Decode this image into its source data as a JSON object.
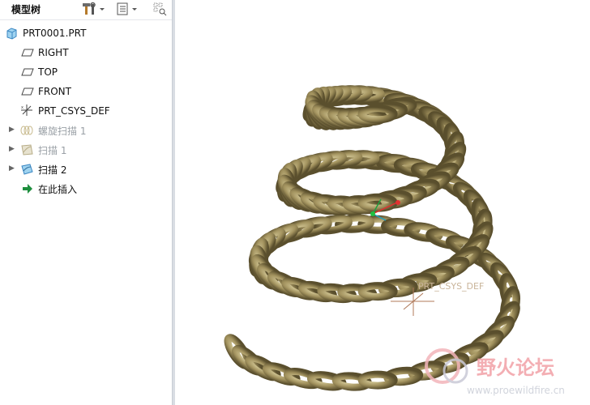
{
  "panel": {
    "title": "模型树"
  },
  "tree": {
    "root": "PRT0001.PRT",
    "items": [
      {
        "label": "RIGHT",
        "icon": "datum-plane-icon",
        "dim": false
      },
      {
        "label": "TOP",
        "icon": "datum-plane-icon",
        "dim": false
      },
      {
        "label": "FRONT",
        "icon": "datum-plane-icon",
        "dim": false
      },
      {
        "label": "PRT_CSYS_DEF",
        "icon": "csys-icon",
        "dim": false
      },
      {
        "label": "螺旋扫描 1",
        "icon": "helical-sweep-icon",
        "dim": true
      },
      {
        "label": "扫描 1",
        "icon": "sweep-icon",
        "dim": true
      },
      {
        "label": "扫描 2",
        "icon": "sweep-icon",
        "dim": false
      },
      {
        "label": "在此插入",
        "icon": "insert-here-icon",
        "dim": false
      }
    ]
  },
  "viewport": {
    "csys_label": "PRT_CSYS_DEF",
    "watermark_cn": "野火论坛",
    "watermark_url": "www.proewildfire.cn"
  },
  "colors": {
    "coil": "#8a7a4a",
    "coil_highlight": "#cfc391",
    "watermark": "#f2a0a6"
  }
}
